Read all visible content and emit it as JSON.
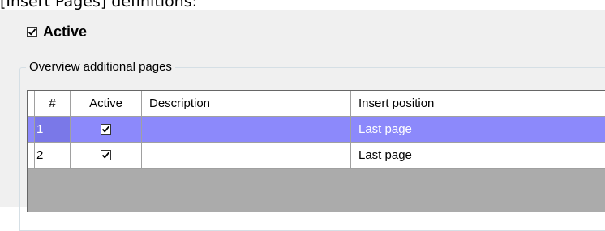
{
  "caption": "[Insert Pages] definitions:",
  "active_checkbox": {
    "label": "Active",
    "checked": true
  },
  "group": {
    "title": "Overview additional pages"
  },
  "grid": {
    "columns": [
      "#",
      "Active",
      "Description",
      "Insert position"
    ],
    "rows": [
      {
        "num": "1",
        "active": true,
        "description": "",
        "position": "Last page",
        "selected": true
      },
      {
        "num": "2",
        "active": true,
        "description": "",
        "position": "Last page",
        "selected": false
      }
    ]
  },
  "colors": {
    "selection": "#8c89fb",
    "panel": "#f0f0f0",
    "grid_empty": "#ababab"
  }
}
